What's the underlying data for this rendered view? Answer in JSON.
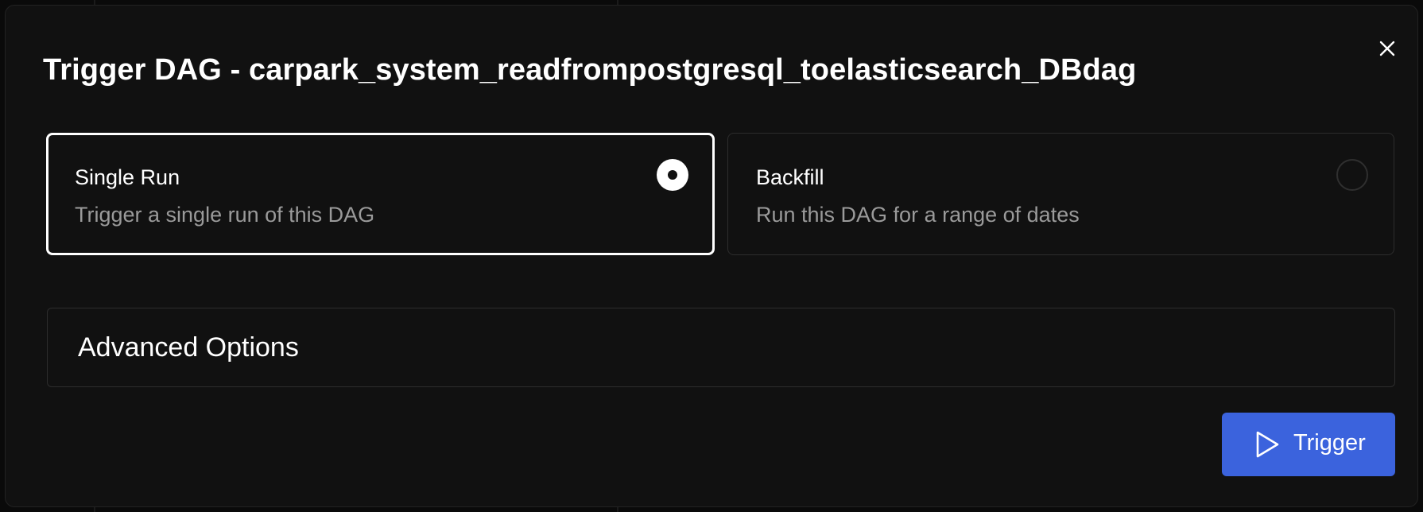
{
  "dialog": {
    "title": "Trigger DAG - carpark_system_readfrompostgresql_toelasticsearch_DBdag",
    "close_icon": "close-icon"
  },
  "run_options": [
    {
      "title": "Single Run",
      "description": "Trigger a single run of this DAG",
      "selected": true
    },
    {
      "title": "Backfill",
      "description": "Run this DAG for a range of dates",
      "selected": false
    }
  ],
  "advanced": {
    "label": "Advanced Options"
  },
  "footer": {
    "trigger_label": "Trigger",
    "trigger_icon": "play-icon"
  },
  "colors": {
    "background": "#111111",
    "accent": "#3b63dd",
    "text_primary": "#ffffff",
    "text_secondary": "#9a9a9a",
    "border": "#2d2d2d"
  }
}
